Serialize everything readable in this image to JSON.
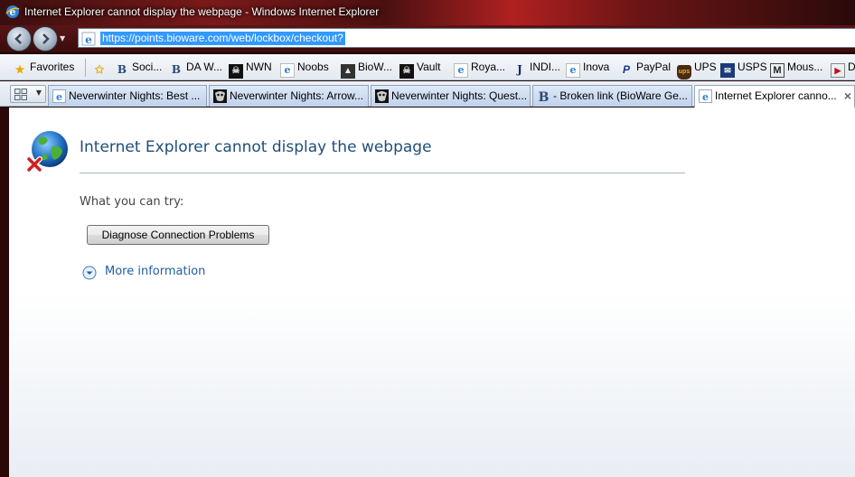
{
  "window": {
    "title": "Internet Explorer cannot display the webpage - Windows Internet Explorer"
  },
  "address_bar": {
    "url": "https://points.bioware.com/web/lockbox/checkout?"
  },
  "favorites_bar": {
    "favorites_label": "Favorites",
    "items": [
      {
        "label": "Soci...",
        "icon": "bioware-b-icon"
      },
      {
        "label": "DA W...",
        "icon": "bioware-b-icon"
      },
      {
        "label": "NWN",
        "icon": "nwn-mask-icon"
      },
      {
        "label": "Noobs",
        "icon": "ie-page-icon"
      },
      {
        "label": "BioW...",
        "icon": "bioware-logo-icon"
      },
      {
        "label": "Vault",
        "icon": "nwn-mask-icon"
      },
      {
        "label": "Roya...",
        "icon": "ie-page-icon"
      },
      {
        "label": "INDI...",
        "icon": "indi-icon"
      },
      {
        "label": "Inova",
        "icon": "ie-page-icon"
      },
      {
        "label": "PayPal",
        "icon": "paypal-icon"
      },
      {
        "label": "UPS",
        "icon": "ups-icon"
      },
      {
        "label": "USPS",
        "icon": "usps-icon"
      },
      {
        "label": "Mous...",
        "icon": "m-icon"
      },
      {
        "label": "D",
        "icon": "red-play-icon"
      }
    ]
  },
  "tabs": [
    {
      "label": "Neverwinter Nights: Best ...",
      "icon": "ie-page-icon",
      "active": false
    },
    {
      "label": "Neverwinter Nights: Arrow...",
      "icon": "nwn-mask-icon",
      "active": false
    },
    {
      "label": "Neverwinter Nights: Quest...",
      "icon": "nwn-mask-icon",
      "active": false
    },
    {
      "label": "- Broken link (BioWare Ge...",
      "icon": "bioware-b-icon",
      "active": false
    },
    {
      "label": "Internet Explorer canno...",
      "icon": "ie-page-icon",
      "active": true
    }
  ],
  "error_page": {
    "title": "Internet Explorer cannot display the webpage",
    "try_label": "What you can try:",
    "diagnose_button": "Diagnose Connection Problems",
    "more_info": "More information"
  },
  "colors": {
    "title_blue": "#1f4e79",
    "link_blue": "#1f5fa0",
    "url_highlight": "#3399ff"
  }
}
